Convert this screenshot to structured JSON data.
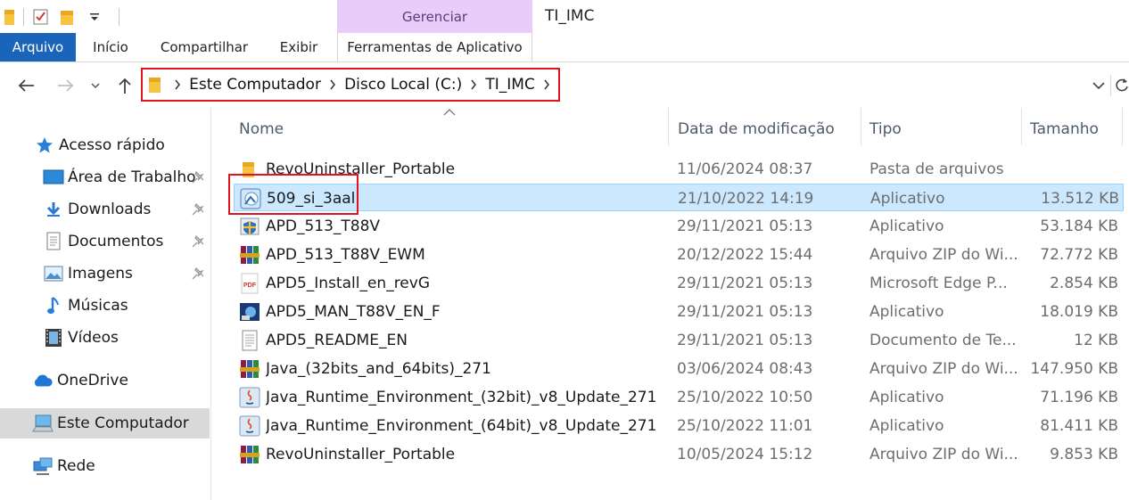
{
  "window": {
    "title": "TI_IMC"
  },
  "ribbon": {
    "context_header": "Gerenciar",
    "tabs": [
      {
        "label": "Arquivo"
      },
      {
        "label": "Início"
      },
      {
        "label": "Compartilhar"
      },
      {
        "label": "Exibir"
      },
      {
        "label": "Ferramentas de Aplicativo"
      }
    ]
  },
  "address": {
    "crumbs": [
      "Este Computador",
      "Disco Local (C:)",
      "TI_IMC"
    ]
  },
  "nav": {
    "items": [
      {
        "label": "Acesso rápido",
        "icon": "star-icon"
      },
      {
        "label": "Área de Trabalho",
        "icon": "desktop-icon",
        "pinned": true
      },
      {
        "label": "Downloads",
        "icon": "download-arrow-icon",
        "pinned": true
      },
      {
        "label": "Documentos",
        "icon": "document-icon",
        "pinned": true
      },
      {
        "label": "Imagens",
        "icon": "picture-icon",
        "pinned": true
      },
      {
        "label": "Músicas",
        "icon": "music-note-icon"
      },
      {
        "label": "Vídeos",
        "icon": "film-icon"
      },
      {
        "label": "OneDrive",
        "icon": "cloud-icon"
      },
      {
        "label": "Este Computador",
        "icon": "computer-icon",
        "selected": true
      },
      {
        "label": "Rede",
        "icon": "network-icon"
      }
    ]
  },
  "columns": {
    "name": "Nome",
    "date": "Data de modificação",
    "type": "Tipo",
    "size": "Tamanho"
  },
  "files": [
    {
      "name": "RevoUninstaller_Portable",
      "date": "11/06/2024 08:37",
      "type": "Pasta de arquivos",
      "size": "",
      "icon": "folder-icon"
    },
    {
      "name": "509_si_3aal",
      "date": "21/10/2022 14:19",
      "type": "Aplicativo",
      "size": "13.512 KB",
      "icon": "installer-app-icon",
      "selected": true
    },
    {
      "name": "APD_513_T88V",
      "date": "29/11/2021 05:13",
      "type": "Aplicativo",
      "size": "53.184 KB",
      "icon": "shield-app-icon"
    },
    {
      "name": "APD_513_T88V_EWM",
      "date": "20/12/2022 15:44",
      "type": "Arquivo ZIP do Wi...",
      "size": "72.772 KB",
      "icon": "winrar-archive-icon"
    },
    {
      "name": "APD5_Install_en_revG",
      "date": "29/11/2021 05:13",
      "type": "Microsoft Edge P...",
      "size": "2.854 KB",
      "icon": "pdf-icon"
    },
    {
      "name": "APD5_MAN_T88V_EN_F",
      "date": "29/11/2021 05:13",
      "type": "Aplicativo",
      "size": "18.019 KB",
      "icon": "setup-app-icon"
    },
    {
      "name": "APD5_README_EN",
      "date": "29/11/2021 05:13",
      "type": "Documento de Te...",
      "size": "12 KB",
      "icon": "text-document-icon"
    },
    {
      "name": "Java_(32bits_and_64bits)_271",
      "date": "03/06/2024 08:43",
      "type": "Arquivo ZIP do Wi...",
      "size": "147.950 KB",
      "icon": "winrar-archive-icon"
    },
    {
      "name": "Java_Runtime_Environment_(32bit)_v8_Update_271",
      "date": "25/10/2022 10:50",
      "type": "Aplicativo",
      "size": "71.196 KB",
      "icon": "java-app-icon"
    },
    {
      "name": "Java_Runtime_Environment_(64bit)_v8_Update_271",
      "date": "25/10/2022 11:01",
      "type": "Aplicativo",
      "size": "81.411 KB",
      "icon": "java-app-icon"
    },
    {
      "name": "RevoUninstaller_Portable",
      "date": "10/05/2024 15:12",
      "type": "Arquivo ZIP do Wi...",
      "size": "9.853 KB",
      "icon": "winrar-archive-icon"
    }
  ],
  "colors": {
    "accent": "#1a65b9",
    "context_tab": "#e8cdfb",
    "selection": "#cce8ff",
    "highlight_box": "#e0141e"
  }
}
